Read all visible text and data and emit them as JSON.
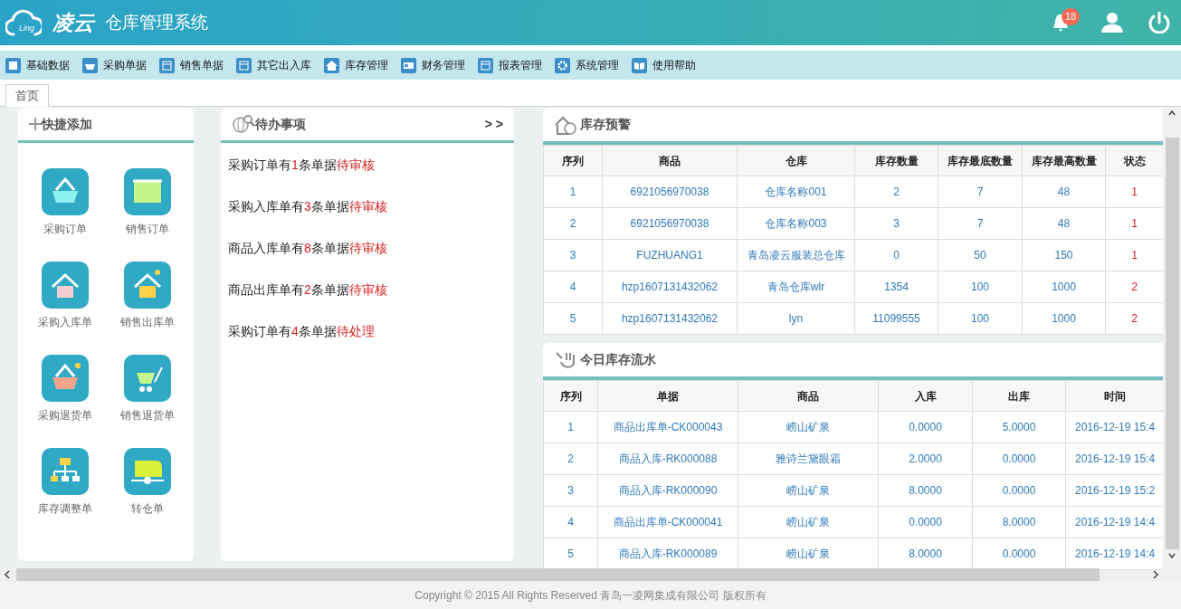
{
  "header": {
    "logo_sub": "Ling",
    "brand": "凌云",
    "title": "仓库管理系统",
    "notification_count": "18"
  },
  "menu": [
    "基础数据",
    "采购单据",
    "销售单据",
    "其它出入库",
    "库存管理",
    "财务管理",
    "报表管理",
    "系统管理",
    "使用帮助"
  ],
  "tabs": [
    {
      "label": "首页",
      "selected": true
    }
  ],
  "quick_add": {
    "title": "快捷添加",
    "items": [
      "采购订单",
      "销售订单",
      "采购入库单",
      "销售出库单",
      "采购退货单",
      "销售退货单",
      "库存调整单",
      "转仓单"
    ]
  },
  "todo": {
    "title": "待办事项",
    "more": "> >",
    "items": [
      {
        "prefix": "采购订单有",
        "count": "1",
        "suffix": "条单据",
        "status": "待审核"
      },
      {
        "prefix": "采购入库单有",
        "count": "3",
        "suffix": "条单据",
        "status": "待审核"
      },
      {
        "prefix": "商品入库单有",
        "count": "8",
        "suffix": "条单据",
        "status": "待审核"
      },
      {
        "prefix": "商品出库单有",
        "count": "2",
        "suffix": "条单据",
        "status": "待审核"
      },
      {
        "prefix": "采购订单有",
        "count": "4",
        "suffix": "条单据",
        "status": "待处理"
      }
    ]
  },
  "stock_warning": {
    "title": "库存预警",
    "columns": [
      "序列",
      "商品",
      "仓库",
      "库存数量",
      "库存最底数量",
      "库存最高数量",
      "状态"
    ],
    "rows": [
      [
        "1",
        "6921056970038",
        "仓库名称001",
        "2",
        "7",
        "48",
        "1"
      ],
      [
        "2",
        "6921056970038",
        "仓库名称003",
        "3",
        "7",
        "48",
        "1"
      ],
      [
        "3",
        "FUZHUANG1",
        "青岛凌云服装总仓库",
        "0",
        "50",
        "150",
        "1"
      ],
      [
        "4",
        "hzp1607131432062",
        "青岛仓库wlr",
        "1354",
        "100",
        "1000",
        "2"
      ],
      [
        "5",
        "hzp1607131432062",
        "lyn",
        "11099555",
        "100",
        "1000",
        "2"
      ]
    ]
  },
  "stock_flow": {
    "title": "今日库存流水",
    "columns": [
      "序列",
      "单据",
      "商品",
      "入库",
      "出库",
      "时间"
    ],
    "rows": [
      [
        "1",
        "商品出库单-CK000043",
        "崂山矿泉",
        "0.0000",
        "5.0000",
        "2016-12-19 15:4"
      ],
      [
        "2",
        "商品入库-RK000088",
        "雅诗兰黛眼霜",
        "2.0000",
        "0.0000",
        "2016-12-19 15:4"
      ],
      [
        "3",
        "商品入库-RK000090",
        "崂山矿泉",
        "8.0000",
        "0.0000",
        "2016-12-19 15:2"
      ],
      [
        "4",
        "商品出库单-CK000041",
        "崂山矿泉",
        "0.0000",
        "8.0000",
        "2016-12-19 14:4"
      ],
      [
        "5",
        "商品入库-RK000089",
        "崂山矿泉",
        "8.0000",
        "0.0000",
        "2016-12-19 14:4"
      ]
    ]
  },
  "footer": "Copyright © 2015 All Rights Reserved 青岛一凌网集成有限公司 版权所有"
}
